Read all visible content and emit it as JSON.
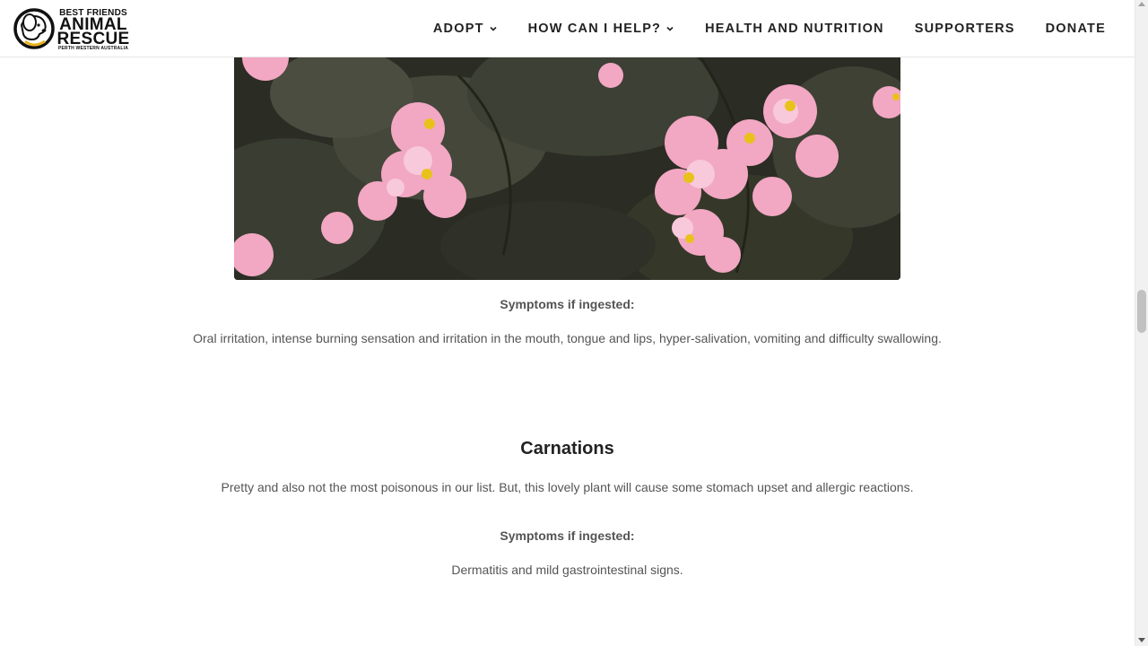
{
  "logo": {
    "line1": "BEST FRIENDS",
    "line2": "ANIMAL",
    "line3": "RESCUE",
    "line4": "PERTH WESTERN AUSTRALIA"
  },
  "nav": {
    "items": [
      {
        "label": "ADOPT",
        "dropdown": true
      },
      {
        "label": "HOW CAN I HELP?",
        "dropdown": true
      },
      {
        "label": "HEALTH AND NUTRITION",
        "dropdown": false
      },
      {
        "label": "SUPPORTERS",
        "dropdown": false
      },
      {
        "label": "DONATE",
        "dropdown": false
      }
    ]
  },
  "begonia": {
    "symptoms_label": "Symptoms if ingested:",
    "symptoms_text": "Oral irritation, intense burning sensation and irritation in the mouth, tongue and lips, hyper-salivation, vomiting and difficulty swallowing."
  },
  "carnations": {
    "title": "Carnations",
    "description": "Pretty and also not the most poisonous in our list. But, this lovely plant will cause some stomach upset and allergic reactions.",
    "symptoms_label": "Symptoms if ingested:",
    "symptoms_text": "Dermatitis and mild gastrointestinal signs."
  },
  "colors": {
    "text": "#555555",
    "heading": "#222222",
    "flower_pink": "#f2a7c3",
    "leaf_dark": "#2f3327"
  }
}
